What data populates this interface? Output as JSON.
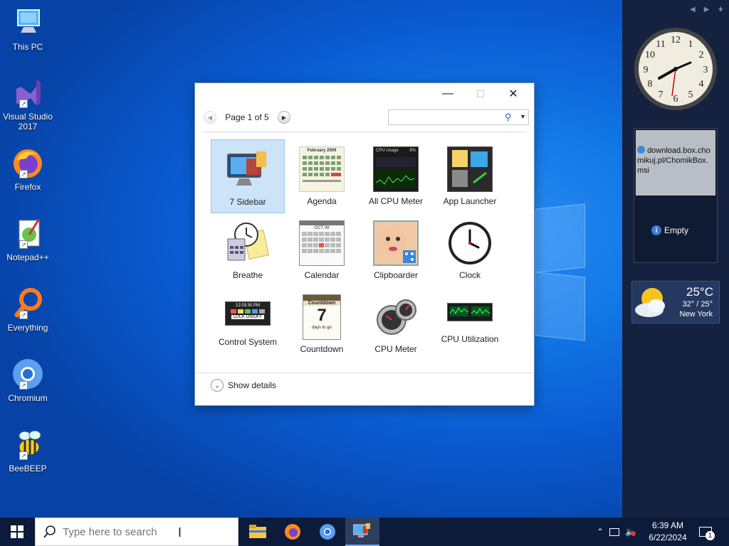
{
  "desktop": {
    "icons": [
      {
        "label": "This PC"
      },
      {
        "label": "Visual Studio 2017"
      },
      {
        "label": "Firefox"
      },
      {
        "label": "Notepad++"
      },
      {
        "label": "Everything"
      },
      {
        "label": "Chromium"
      },
      {
        "label": "BeeBEEP"
      }
    ]
  },
  "dialog": {
    "page_label": "Page 1 of 5",
    "search_value": "",
    "gadgets": [
      {
        "label": "7 Sidebar",
        "selected": true
      },
      {
        "label": "Agenda"
      },
      {
        "label": "All CPU Meter"
      },
      {
        "label": "App Launcher"
      },
      {
        "label": "Breathe"
      },
      {
        "label": "Calendar"
      },
      {
        "label": "Clipboarder"
      },
      {
        "label": "Clock"
      },
      {
        "label": "Control System"
      },
      {
        "label": "Countdown"
      },
      {
        "label": "CPU Meter"
      },
      {
        "label": "CPU Utilization"
      }
    ],
    "show_details": "Show details",
    "thumb_text": {
      "agenda_title": "February 2009",
      "cpu_usage": "CPU Usage",
      "cpu_pct": "8%",
      "control_time": "12:03:30 PM",
      "control_lock": "LOCK ON/OFF",
      "countdown_title": "Countdown",
      "countdown_num": "7",
      "countdown_sub": "days to go",
      "cal_month": "OCT 08"
    }
  },
  "sidebar": {
    "slideshow_link": "download.box.chomikuj.pl/ChomikBox.msi",
    "slideshow_empty": "Empty",
    "weather": {
      "temp": "25°C",
      "range": "32° / 25°",
      "city": "New York"
    }
  },
  "taskbar": {
    "search_placeholder": "Type here to search",
    "time": "6:39 AM",
    "date": "6/22/2024",
    "notification_count": "1"
  },
  "colors": {
    "accent": "#0a5ad0",
    "selection": "#cde3f8",
    "taskbar": "#0c1b3a",
    "sidebar": "#142240"
  }
}
